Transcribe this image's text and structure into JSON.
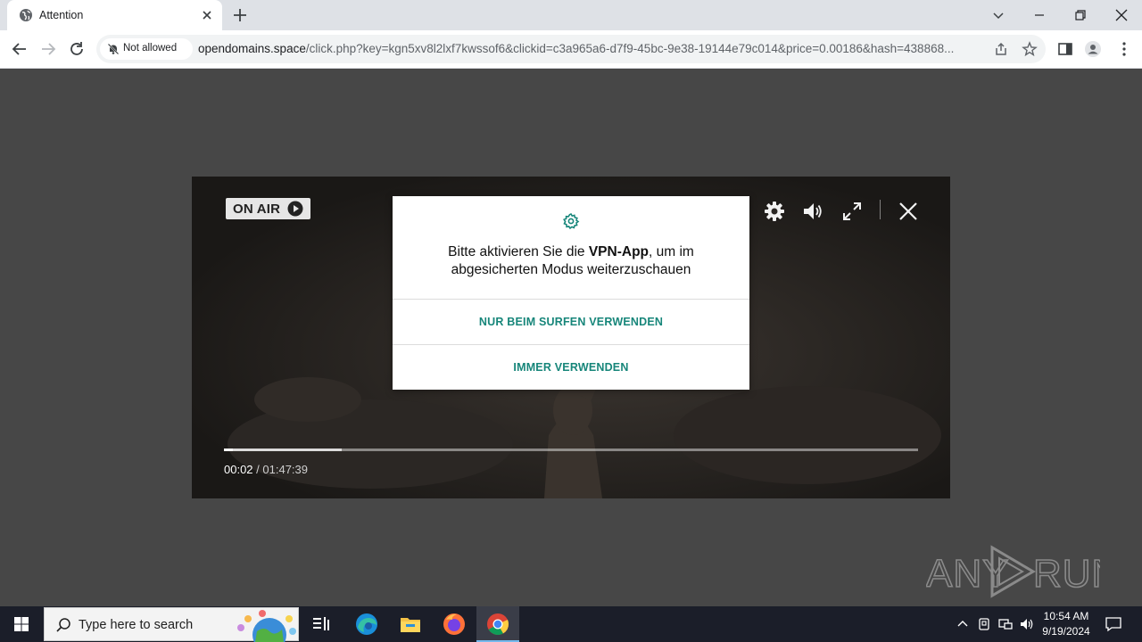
{
  "browser": {
    "tab_title": "Attention",
    "permission_chip": "Not allowed",
    "url_host": "opendomains.space",
    "url_path": "/click.php?key=kgn5xv8l2lxf7kwssof6&clickid=c3a965a6-d7f9-45bc-9e38-19144e79c014&price=0.00186&hash=438868..."
  },
  "player": {
    "on_air_label": "ON AIR",
    "current_time": "00:02",
    "time_separator": " / ",
    "total_time": "01:47:39",
    "progress_played": 0.013,
    "progress_buffered": 0.17
  },
  "dialog": {
    "message_prefix": "Bitte aktivieren Sie die ",
    "message_bold": "VPN-App",
    "message_suffix": ", um im abgesicherten Modus weiterzuschauen",
    "button_surfing": "NUR BEIM SURFEN VERWENDEN",
    "button_always": "IMMER VERWENDEN",
    "accent_color": "#17867a"
  },
  "watermark": {
    "text": "ANY RUN"
  },
  "taskbar": {
    "search_placeholder": "Type here to search",
    "time": "10:54 AM",
    "date": "9/19/2024"
  },
  "icons": [
    "globe-icon",
    "close-icon",
    "plus-icon",
    "chevron-down-icon",
    "minimize-icon",
    "restore-icon",
    "back-icon",
    "forward-icon",
    "reload-icon",
    "bell-off-icon",
    "share-icon",
    "star-icon",
    "sidepanel-icon",
    "profile-icon",
    "menu-icon",
    "play-icon",
    "gear-icon",
    "volume-icon",
    "fullscreen-icon",
    "windows-icon",
    "search-icon",
    "taskview-icon",
    "edge-icon",
    "folder-icon",
    "firefox-icon",
    "chrome-icon",
    "chevron-up-icon",
    "network-icon",
    "notification-icon"
  ]
}
